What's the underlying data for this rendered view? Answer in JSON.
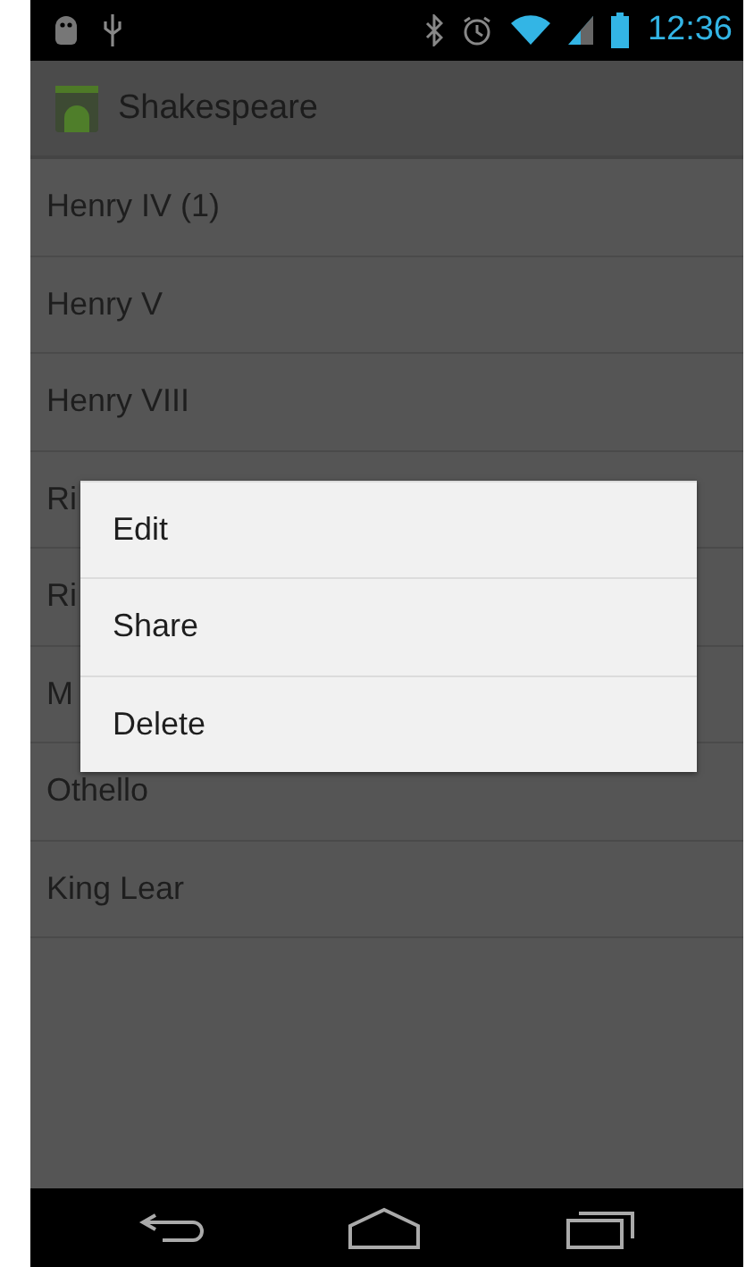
{
  "status_bar": {
    "time": "12:36"
  },
  "action_bar": {
    "title": "Shakespeare"
  },
  "list": {
    "items": [
      {
        "label": "Henry IV (1)"
      },
      {
        "label": "Henry V"
      },
      {
        "label": "Henry VIII"
      },
      {
        "label": "Ri"
      },
      {
        "label": "Ri"
      },
      {
        "label": "M"
      },
      {
        "label": "Othello"
      },
      {
        "label": "King Lear"
      }
    ]
  },
  "context_menu": {
    "items": [
      {
        "label": "Edit"
      },
      {
        "label": "Share"
      },
      {
        "label": "Delete"
      }
    ]
  }
}
